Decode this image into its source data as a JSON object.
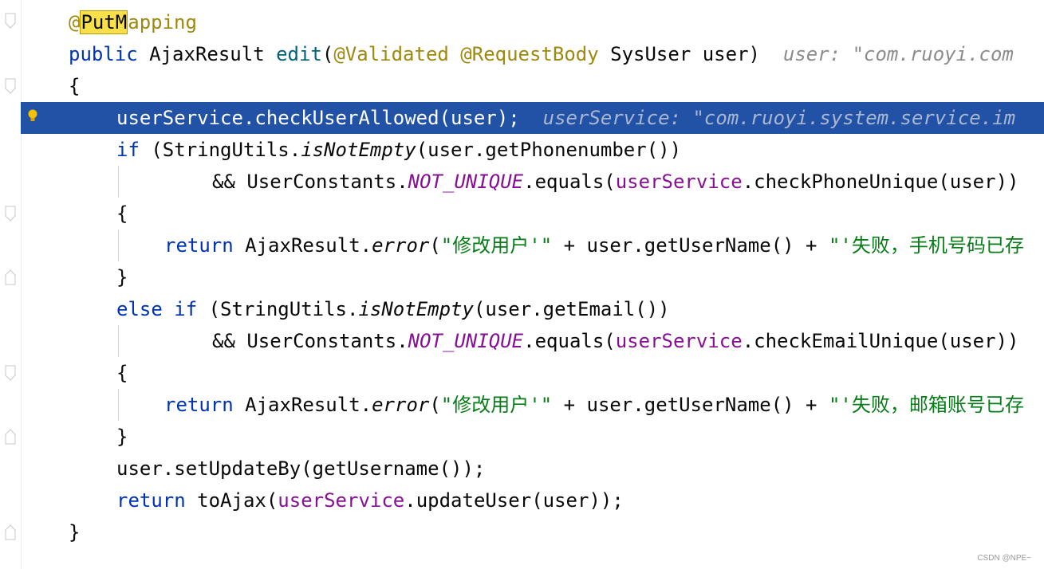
{
  "code": {
    "l01": {
      "ann_highlight": "PutM",
      "ann_rest": "apping",
      "at": "@"
    },
    "l02": {
      "kw_public": "public",
      "type": " AjaxResult ",
      "method": "edit",
      "paren": "(",
      "ann1": "@Validated",
      "ann2": "@RequestBody",
      "params": " SysUser user)",
      "hint": "user: \"com.ruoyi.com"
    },
    "l03": {
      "text": "{"
    },
    "l04": {
      "text": "userService.checkUserAllowed(user);",
      "hint": "userService: \"com.ruoyi.system.service.im"
    },
    "l05": {
      "kw": "if",
      "p1": " (StringUtils.",
      "method": "isNotEmpty",
      "p2": "(user.getPhonenumber())"
    },
    "l06": {
      "p1": "&& UserConstants.",
      "const": "NOT_UNIQUE",
      "p2": ".equals(",
      "field": "userService",
      "p3": ".checkPhoneUnique(user))"
    },
    "l07": {
      "text": "{"
    },
    "l08": {
      "kw": "return",
      "p1": " AjaxResult.",
      "method": "error",
      "p2": "(",
      "s1": "\"修改用户'\"",
      "p3": " + user.getUserName() + ",
      "s2": "\"'失败，手机号码已存"
    },
    "l09": {
      "text": "}"
    },
    "l10": {
      "kw1": "else",
      "kw2": "if",
      "p1": " (StringUtils.",
      "method": "isNotEmpty",
      "p2": "(user.getEmail())"
    },
    "l11": {
      "p1": "&& UserConstants.",
      "const": "NOT_UNIQUE",
      "p2": ".equals(",
      "field": "userService",
      "p3": ".checkEmailUnique(user))"
    },
    "l12": {
      "text": "{"
    },
    "l13": {
      "kw": "return",
      "p1": " AjaxResult.",
      "method": "error",
      "p2": "(",
      "s1": "\"修改用户'\"",
      "p3": " + user.getUserName() + ",
      "s2": "\"'失败，邮箱账号已存"
    },
    "l14": {
      "text": "}"
    },
    "l15": {
      "text": "user.setUpdateBy(getUsername());"
    },
    "l16": {
      "kw": "return",
      "p1": " toAjax(",
      "field": "userService",
      "p2": ".updateUser(user));"
    },
    "l17": {
      "text": "}"
    }
  },
  "watermark": "CSDN @NPE~",
  "colors": {
    "keyword": "#0033b3",
    "annotation": "#9e880d",
    "field": "#871094",
    "string": "#067d17",
    "selection": "#2252a6",
    "hint": "#8c8c8c"
  },
  "icons": [
    "fold-icon",
    "intention-bulb-icon"
  ]
}
